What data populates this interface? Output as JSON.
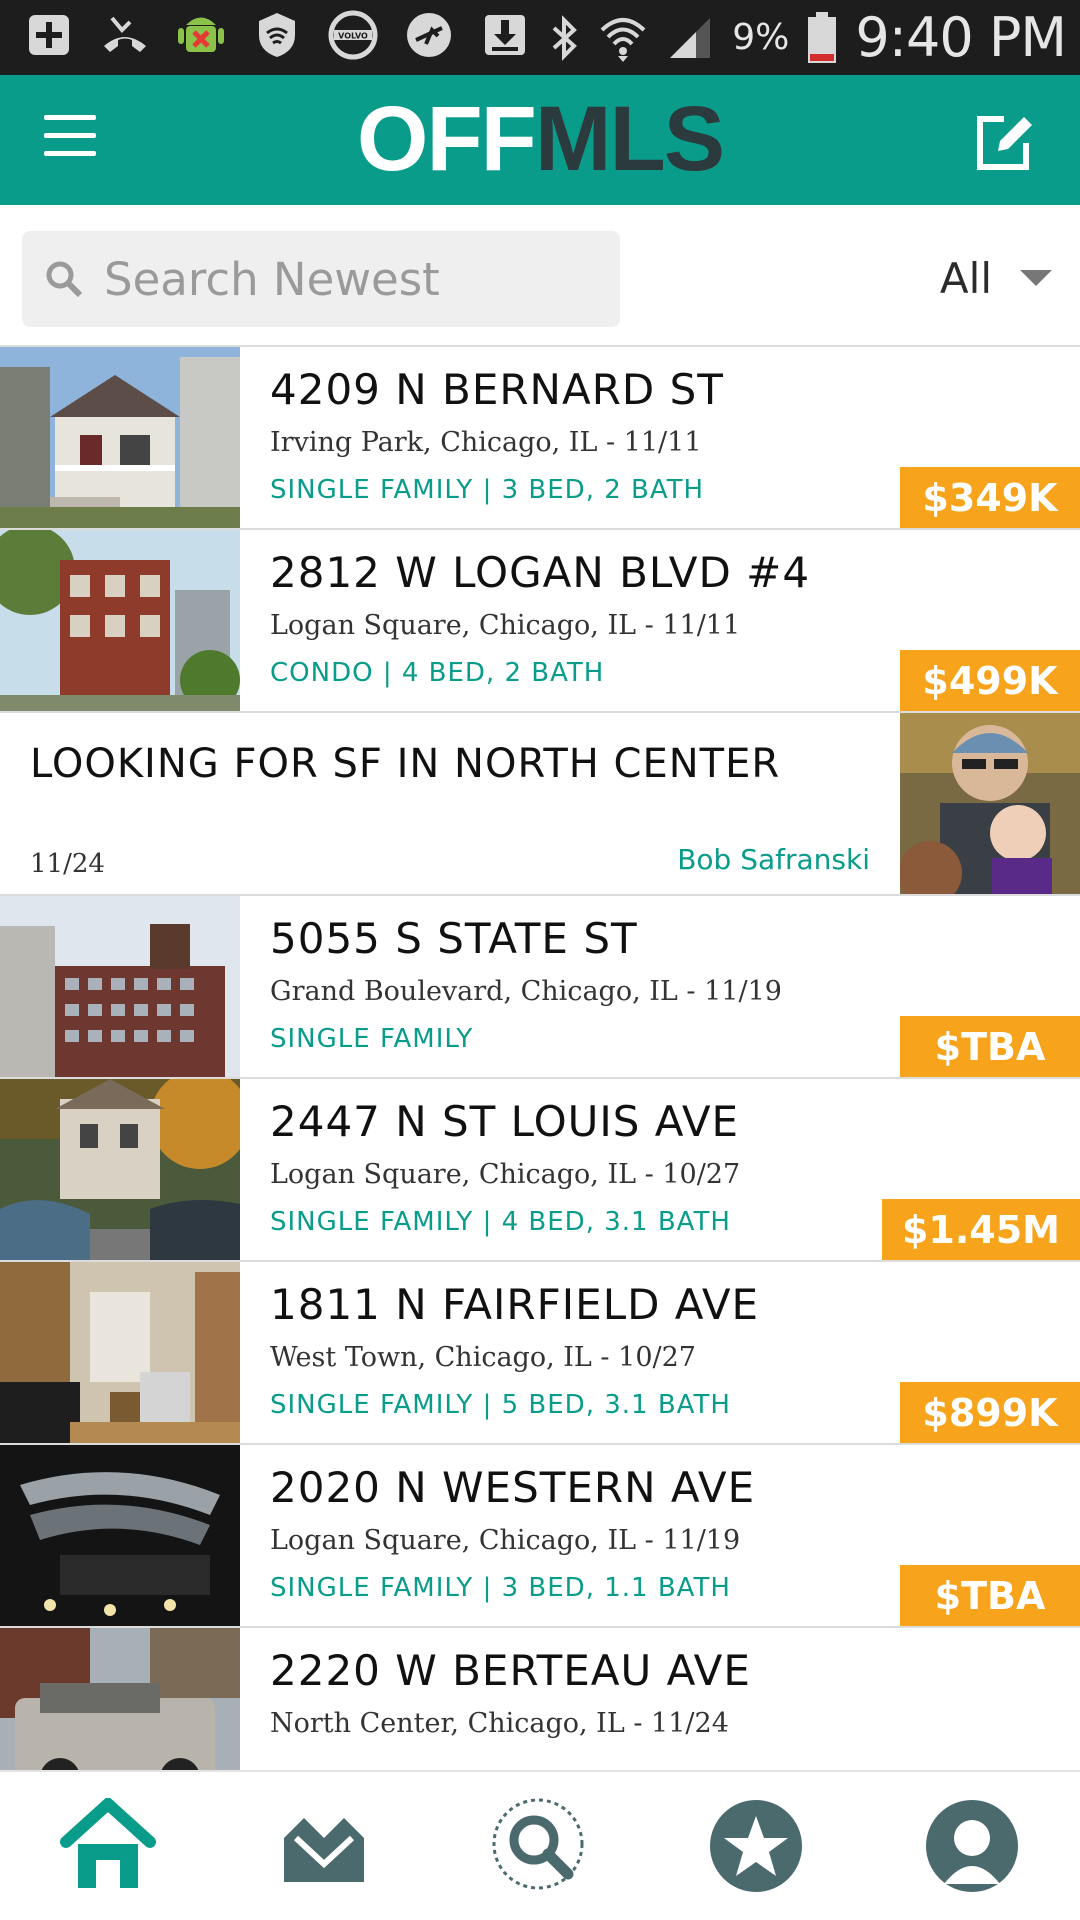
{
  "status_bar": {
    "battery_pct": "9%",
    "time": "9:40 PM"
  },
  "app": {
    "logo_off": "OFF",
    "logo_mls": "MLS",
    "colors": {
      "primary": "#0a9c8b",
      "logo_dark": "#2b3a3c",
      "price": "#f7a31b"
    }
  },
  "search": {
    "placeholder": "Search Newest",
    "filter_value": "All"
  },
  "listings": [
    {
      "address": "4209 N BERNARD ST",
      "location": "Irving Park, Chicago, IL  -  11/11",
      "type": "SINGLE FAMILY | 3 BED, 2 BATH",
      "price": "$349K"
    },
    {
      "address": "2812 W LOGAN BLVD #4",
      "location": "Logan Square, Chicago, IL  -  11/11",
      "type": "CONDO | 4 BED, 2 BATH",
      "price": "$499K"
    }
  ],
  "wanted": {
    "title": "LOOKING FOR SF IN NORTH CENTER",
    "date": "11/24",
    "author": "Bob Safranski"
  },
  "listings2": [
    {
      "address": "5055 S STATE ST",
      "location": "Grand Boulevard, Chicago, IL  -  11/19",
      "type": "SINGLE FAMILY",
      "price": "$TBA"
    },
    {
      "address": "2447 N ST LOUIS AVE",
      "location": "Logan Square, Chicago, IL  -  10/27",
      "type": "SINGLE FAMILY | 4 BED, 3.1 BATH",
      "price": "$1.45M"
    },
    {
      "address": "1811 N FAIRFIELD AVE",
      "location": "West Town, Chicago, IL  -  10/27",
      "type": "SINGLE FAMILY | 5 BED, 3.1 BATH",
      "price": "$899K"
    },
    {
      "address": "2020 N WESTERN AVE",
      "location": "Logan Square, Chicago, IL  -  11/19",
      "type": "SINGLE FAMILY | 3 BED, 1.1 BATH",
      "price": "$TBA"
    },
    {
      "address": "2220 W BERTEAU AVE",
      "location": "North Center, Chicago, IL  -  11/24",
      "type": "",
      "price": ""
    }
  ],
  "bottom_nav": [
    {
      "icon": "home-icon"
    },
    {
      "icon": "inbox-icon"
    },
    {
      "icon": "search-icon"
    },
    {
      "icon": "star-icon"
    },
    {
      "icon": "profile-icon"
    }
  ]
}
